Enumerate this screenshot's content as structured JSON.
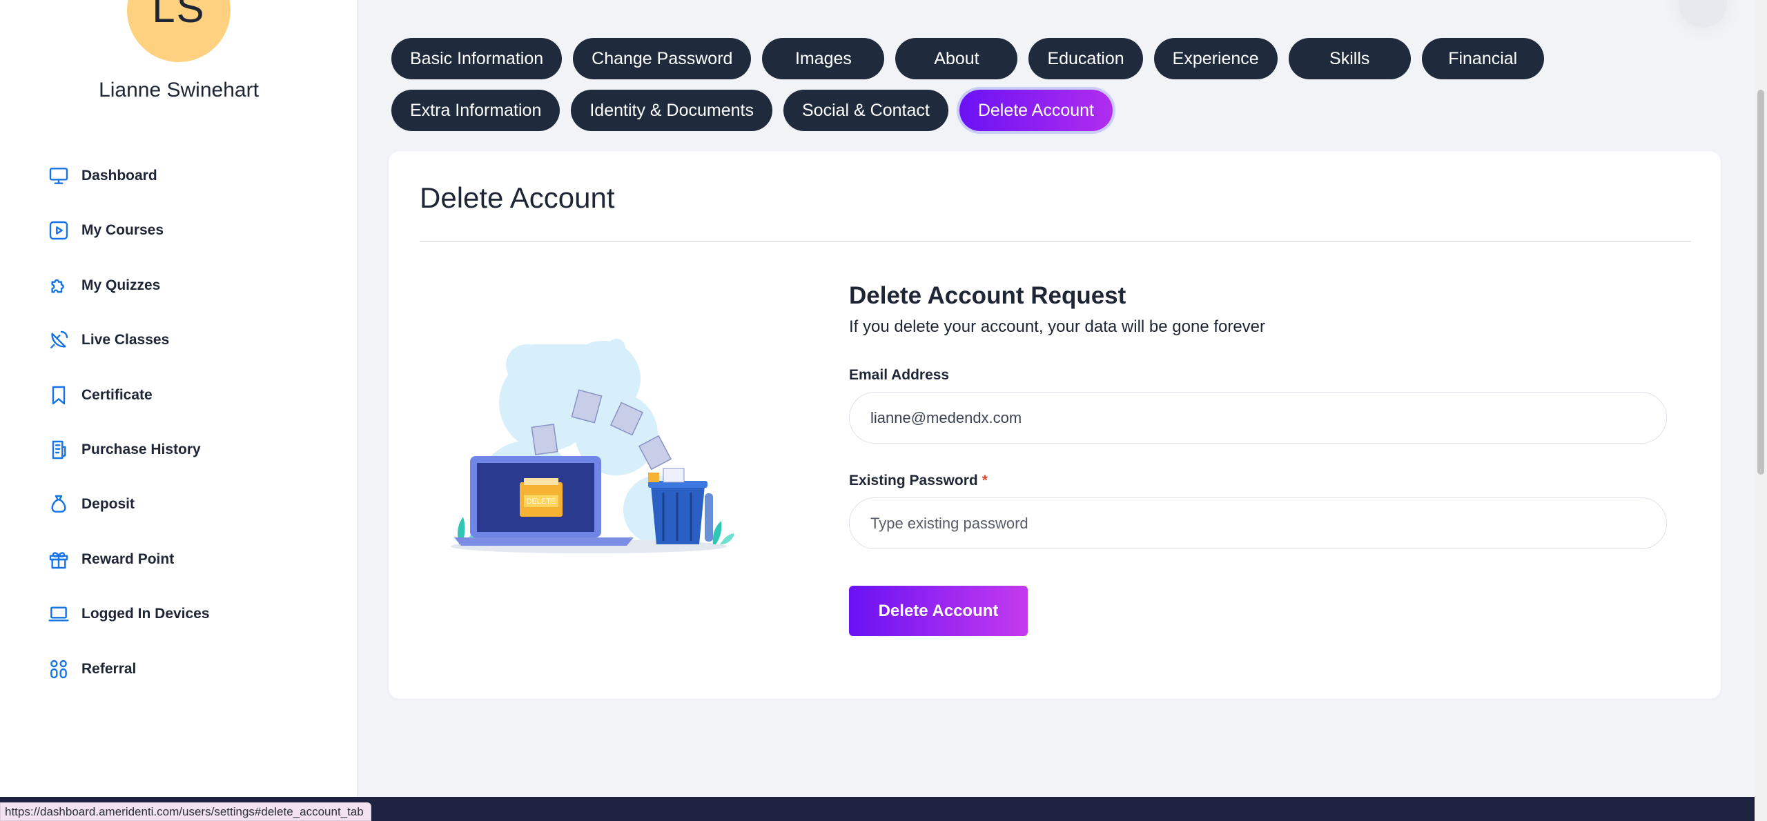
{
  "user": {
    "initials": "LS",
    "name": "Lianne Swinehart"
  },
  "sidebar": {
    "items": [
      {
        "label": "Dashboard",
        "icon": "monitor-icon"
      },
      {
        "label": "My Courses",
        "icon": "play-square-icon"
      },
      {
        "label": "My Quizzes",
        "icon": "puzzle-icon"
      },
      {
        "label": "Live Classes",
        "icon": "satellite-dish-icon"
      },
      {
        "label": "Certificate",
        "icon": "bookmark-icon"
      },
      {
        "label": "Purchase History",
        "icon": "receipt-icon"
      },
      {
        "label": "Deposit",
        "icon": "money-bag-icon"
      },
      {
        "label": "Reward Point",
        "icon": "gift-icon"
      },
      {
        "label": "Logged In Devices",
        "icon": "laptop-icon"
      },
      {
        "label": "Referral",
        "icon": "users-icon"
      }
    ]
  },
  "tabs": {
    "row1": [
      "Basic Information",
      "Change Password",
      "Images",
      "About",
      "Education",
      "Experience",
      "Skills",
      "Financial"
    ],
    "row2": [
      "Extra Information",
      "Identity & Documents",
      "Social & Contact",
      "Delete Account"
    ],
    "active": "Delete Account"
  },
  "card": {
    "title": "Delete Account",
    "request_title": "Delete Account Request",
    "request_subtitle": "If you delete your account, your data will be gone forever",
    "email_label": "Email Address",
    "email_value": "lianne@medendx.com",
    "password_label": "Existing Password",
    "password_required_mark": "*",
    "password_placeholder": "Type existing password",
    "submit_label": "Delete Account",
    "illustration_text": "DELETE"
  },
  "status_bar": {
    "url": "https://dashboard.ameridenti.com/users/settings#delete_account_tab"
  },
  "colors": {
    "accent_start": "#6a12f4",
    "accent_end": "#b12dee",
    "tab_dark": "#1f2b3c",
    "icon_blue": "#1673e6",
    "avatar_bg": "#fdd17f",
    "footer_bar": "#1d2240"
  }
}
